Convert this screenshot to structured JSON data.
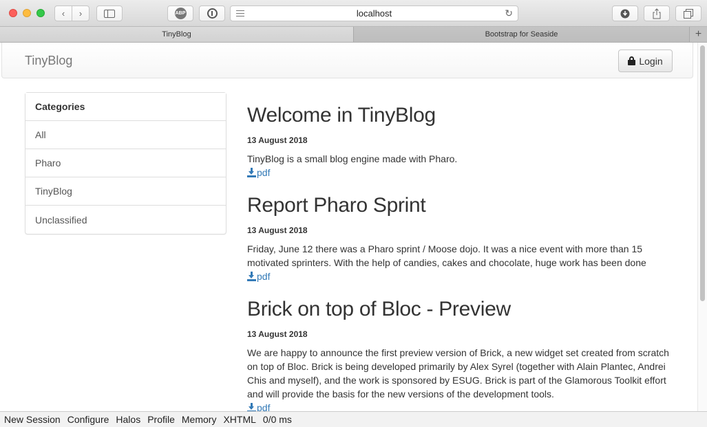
{
  "browser": {
    "url": "localhost",
    "abp_label": "ABP",
    "tabs": [
      {
        "label": "TinyBlog",
        "active": true
      },
      {
        "label": "Bootstrap for Seaside",
        "active": false
      }
    ],
    "new_tab": "+"
  },
  "navbar": {
    "brand": "TinyBlog",
    "login_label": "Login"
  },
  "categories": {
    "heading": "Categories",
    "items": [
      "All",
      "Pharo",
      "TinyBlog",
      "Unclassified"
    ]
  },
  "posts": [
    {
      "title": "Welcome in TinyBlog",
      "date": "13 August 2018",
      "body": "TinyBlog is a small blog engine made with Pharo.",
      "pdf_label": "pdf"
    },
    {
      "title": "Report Pharo Sprint",
      "date": "13 August 2018",
      "body": "Friday, June 12 there was a Pharo sprint / Moose dojo. It was a nice event with more than 15 motivated sprinters. With the help of candies, cakes and chocolate, huge work has been done",
      "pdf_label": "pdf"
    },
    {
      "title": "Brick on top of Bloc - Preview",
      "date": "13 August 2018",
      "body": "We are happy to announce the first preview version of Brick, a new widget set created from scratch on top of Bloc. Brick is being developed primarily by Alex Syrel (together with Alain Plantec, Andrei Chis and myself), and the work is sponsored by ESUG. Brick is part of the Glamorous Toolkit effort and will provide the basis for the new versions of the development tools.",
      "pdf_label": "pdf"
    }
  ],
  "footer": {
    "items": [
      "New Session",
      "Configure",
      "Halos",
      "Profile",
      "Memory",
      "XHTML",
      "0/0 ms"
    ]
  },
  "colors": {
    "link": "#337ab7",
    "text": "#333333"
  }
}
